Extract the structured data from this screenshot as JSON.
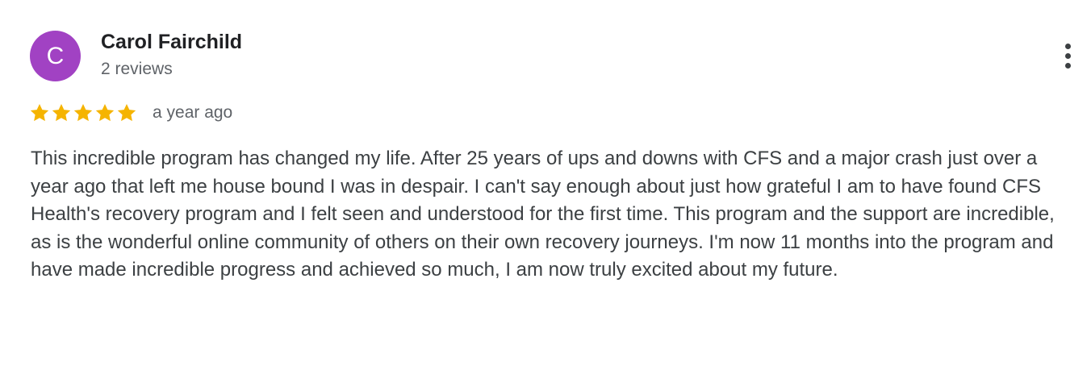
{
  "reviewer": {
    "initial": "C",
    "name": "Carol Fairchild",
    "review_count": "2 reviews",
    "avatar_color": "#a142c3"
  },
  "review": {
    "rating": 5,
    "max_rating": 5,
    "star_color": "#f5b400",
    "date": "a year ago",
    "text": "This incredible program has changed my life. After 25 years of ups and downs with CFS and a major crash just over a year ago that left me house bound I was in despair. I can't say enough about just how grateful I am to have found CFS Health's recovery program and I felt seen and understood for the first time. This program and the support are incredible, as is the wonderful online community of others on their own recovery journeys. I'm now 11 months into the program and have made incredible progress and achieved so much, I am now truly excited about my future."
  },
  "icons": {
    "more": "more-vert-icon",
    "star": "star-icon"
  }
}
